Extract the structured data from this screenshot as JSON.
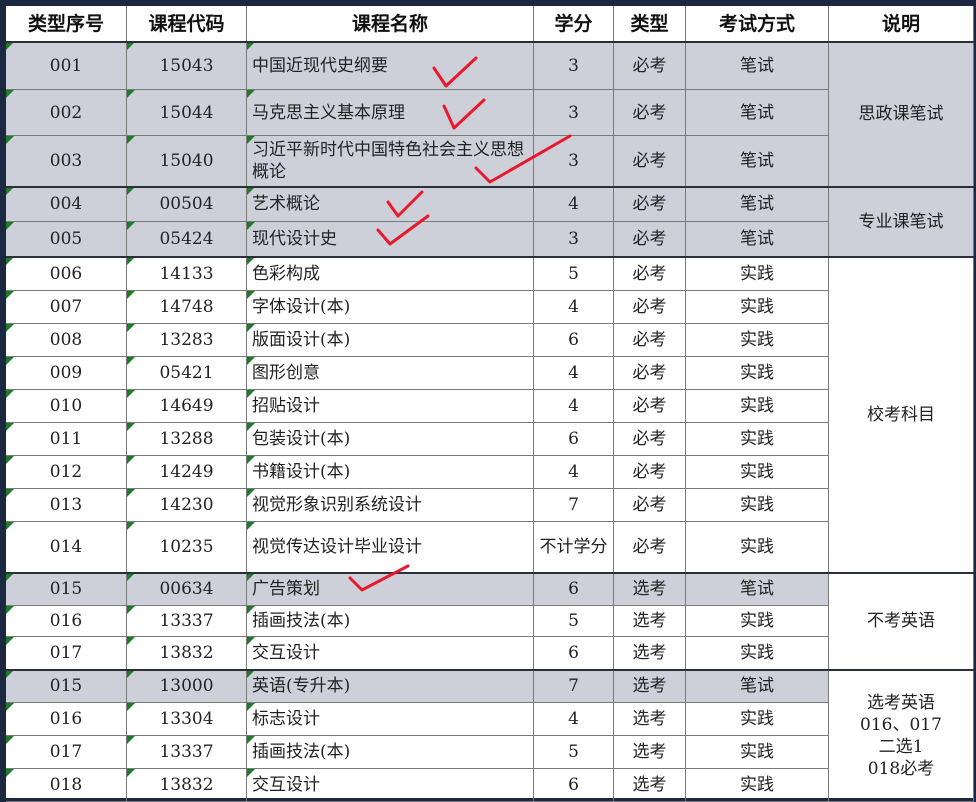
{
  "headers": [
    "类型序号",
    "课程代码",
    "课程名称",
    "学分",
    "类型",
    "考试方式",
    "说明"
  ],
  "rows": [
    {
      "seq": "001",
      "code": "15043",
      "name": "中国近现代史纲要",
      "credit": "3",
      "type": "必考",
      "exam": "笔试",
      "shade": true
    },
    {
      "seq": "002",
      "code": "15044",
      "name": "马克思主义基本原理",
      "credit": "3",
      "type": "必考",
      "exam": "笔试",
      "shade": true
    },
    {
      "seq": "003",
      "code": "15040",
      "name": "习近平新时代中国特色社会主义思想概论",
      "credit": "3",
      "type": "必考",
      "exam": "笔试",
      "shade": true
    },
    {
      "seq": "004",
      "code": "00504",
      "name": "艺术概论",
      "credit": "4",
      "type": "必考",
      "exam": "笔试",
      "shade": true
    },
    {
      "seq": "005",
      "code": "05424",
      "name": "现代设计史",
      "credit": "3",
      "type": "必考",
      "exam": "笔试",
      "shade": true
    },
    {
      "seq": "006",
      "code": "14133",
      "name": "色彩构成",
      "credit": "5",
      "type": "必考",
      "exam": "实践",
      "shade": false
    },
    {
      "seq": "007",
      "code": "14748",
      "name": "字体设计(本)",
      "credit": "4",
      "type": "必考",
      "exam": "实践",
      "shade": false
    },
    {
      "seq": "008",
      "code": "13283",
      "name": "版面设计(本)",
      "credit": "6",
      "type": "必考",
      "exam": "实践",
      "shade": false
    },
    {
      "seq": "009",
      "code": "05421",
      "name": "图形创意",
      "credit": "4",
      "type": "必考",
      "exam": "实践",
      "shade": false
    },
    {
      "seq": "010",
      "code": "14649",
      "name": "招贴设计",
      "credit": "4",
      "type": "必考",
      "exam": "实践",
      "shade": false
    },
    {
      "seq": "011",
      "code": "13288",
      "name": "包装设计(本)",
      "credit": "6",
      "type": "必考",
      "exam": "实践",
      "shade": false
    },
    {
      "seq": "012",
      "code": "14249",
      "name": "书籍设计(本)",
      "credit": "4",
      "type": "必考",
      "exam": "实践",
      "shade": false
    },
    {
      "seq": "013",
      "code": "14230",
      "name": "视觉形象识别系统设计",
      "credit": "7",
      "type": "必考",
      "exam": "实践",
      "shade": false
    },
    {
      "seq": "014",
      "code": "10235",
      "name": "视觉传达设计毕业设计",
      "credit": "不计学分",
      "type": "必考",
      "exam": "实践",
      "shade": false
    },
    {
      "seq": "015",
      "code": "00634",
      "name": "广告策划",
      "credit": "6",
      "type": "选考",
      "exam": "笔试",
      "shade": true
    },
    {
      "seq": "016",
      "code": "13337",
      "name": "插画技法(本)",
      "credit": "5",
      "type": "选考",
      "exam": "实践",
      "shade": false
    },
    {
      "seq": "017",
      "code": "13832",
      "name": "交互设计",
      "credit": "6",
      "type": "选考",
      "exam": "实践",
      "shade": false
    },
    {
      "seq": "015",
      "code": "13000",
      "name": "英语(专升本)",
      "credit": "7",
      "type": "选考",
      "exam": "笔试",
      "shade": true
    },
    {
      "seq": "016",
      "code": "13304",
      "name": "标志设计",
      "credit": "4",
      "type": "选考",
      "exam": "实践",
      "shade": false
    },
    {
      "seq": "017",
      "code": "13337",
      "name": "插画技法(本)",
      "credit": "5",
      "type": "选考",
      "exam": "实践",
      "shade": false
    },
    {
      "seq": "018",
      "code": "13832",
      "name": "交互设计",
      "credit": "6",
      "type": "选考",
      "exam": "实践",
      "shade": false
    }
  ],
  "notes": [
    {
      "text": "思政课笔试",
      "start": 0,
      "end": 2,
      "shade": true
    },
    {
      "text": "专业课笔试",
      "start": 3,
      "end": 4,
      "shade": true
    },
    {
      "text": "校考科目",
      "start": 5,
      "end": 13,
      "shade": false
    },
    {
      "text": "不考英语",
      "start": 14,
      "end": 16,
      "shade": false
    },
    {
      "text": "选考英语\n016、017\n二选1\n018必考",
      "start": 17,
      "end": 20,
      "shade": false
    }
  ],
  "check_marks": {
    "color": "#e8192c",
    "rows": [
      0,
      1,
      2,
      3,
      4,
      14
    ]
  }
}
